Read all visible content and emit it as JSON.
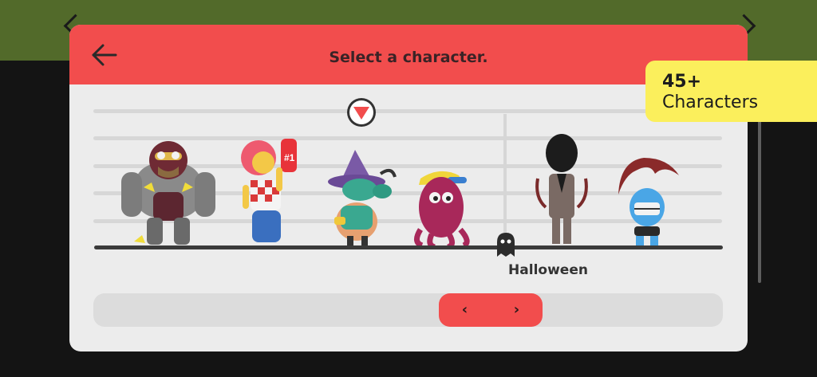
{
  "modal": {
    "title": "Select a character.",
    "back_icon": "arrow-left-icon"
  },
  "colors": {
    "header": "#f24d4d",
    "badge": "#fbef5c",
    "panel": "#ececec",
    "background_top": "#526a2a"
  },
  "characters": [
    {
      "name": "armored-brute",
      "selected": false
    },
    {
      "name": "fan-girl",
      "selected": true
    },
    {
      "name": "witch-goat",
      "selected": false
    },
    {
      "name": "purple-octopus",
      "selected": false
    },
    {
      "name": "slender-man",
      "selected": false
    },
    {
      "name": "blue-troll",
      "selected": false
    }
  ],
  "category": {
    "label": "Halloween",
    "icon": "ghost-icon"
  },
  "navigation": {
    "prev_label": "‹",
    "next_label": "›"
  },
  "badge": {
    "count": "45+",
    "label": "Characters"
  }
}
